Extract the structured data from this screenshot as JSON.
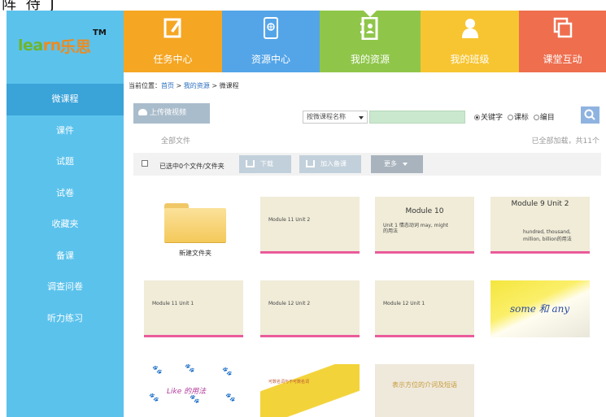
{
  "fragment": {
    "text": "阵 待 J"
  },
  "logo": {
    "word_green": "lea",
    "word_orange": "rn",
    "chinese": "乐思",
    "tm": "TM"
  },
  "sidebar": {
    "items": [
      {
        "label": "微课程",
        "active": true
      },
      {
        "label": "课件"
      },
      {
        "label": "试题"
      },
      {
        "label": "试卷"
      },
      {
        "label": "收藏夹"
      },
      {
        "label": "备课"
      },
      {
        "label": "调查问卷"
      },
      {
        "label": "听力练习"
      }
    ]
  },
  "topnav": {
    "tiles": [
      {
        "label": "任务中心",
        "icon": "edit-icon",
        "color": "#f5a623"
      },
      {
        "label": "资源中心",
        "icon": "tablet-globe-icon",
        "color": "#54a5e8"
      },
      {
        "label": "我的资源",
        "icon": "address-book-icon",
        "color": "#8fc64a",
        "active": true
      },
      {
        "label": "我的班级",
        "icon": "person-icon",
        "color": "#f7c531"
      },
      {
        "label": "课堂互动",
        "icon": "copy-windows-icon",
        "color": "#ee6e4e"
      }
    ]
  },
  "breadcrumb": {
    "prefix": "当前位置：",
    "home": "首页",
    "sep1": " > ",
    "mine": "我的资源",
    "sep2": " > ",
    "current": "微课程"
  },
  "toolbar": {
    "upload_label": "上传微视频",
    "search_select": "按微课程名称",
    "search_value": "",
    "radios": [
      {
        "label": "关键字",
        "checked": true
      },
      {
        "label": "课标"
      },
      {
        "label": "编目"
      }
    ]
  },
  "listing": {
    "all_files": "全部文件",
    "loaded_text": "已全部加载，共11个"
  },
  "actionbar": {
    "selected_text": "已选中0个文件/文件夹",
    "download_label": "下载",
    "cart_label": "加入备课",
    "more_label": "更多"
  },
  "folder": {
    "label": "新建文件夹"
  },
  "thumbs": [
    {
      "caption": "Module 11 Unit 2"
    },
    {
      "title": "Module 10",
      "line1": "Unit 1 情态动词 may, might",
      "line2": "的用法"
    },
    {
      "title": "Module 9 Unit 2",
      "line1": "hundred, thousand,",
      "line2": "million, billion的用法"
    },
    {
      "caption": "Module 11  Unit 1"
    },
    {
      "caption": "Module 12  Unit 2"
    },
    {
      "caption": "Module 12  Unit 1"
    },
    {
      "text": "some 和 any"
    },
    {
      "text": "Like 的用法"
    },
    {
      "caption": "可数名词与不可数名词"
    },
    {
      "text": "表示方位的介词及短语"
    }
  ]
}
